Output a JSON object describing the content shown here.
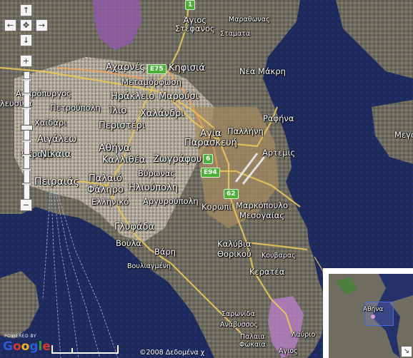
{
  "map": {
    "labels": {
      "agios_stefanos": "Άγιος\nΣτέφανος",
      "stamata": "Σταματα",
      "marathonas": "Μαραθωνας",
      "acharnes": "Αχαρνές",
      "kifisia": "Κηφισιά",
      "metamorfosi": "Μεταμόρφωση",
      "nea_makri": "Νέα Μάκρη",
      "aspropyrgos": "Ασπρόπυργος",
      "irakleio": "Ηράκλειο",
      "marousi": "Μαρούσι",
      "petroupoli": "Πετρούπολη",
      "ilio": "Ίλιο",
      "chalandri": "Χαλάνδρι",
      "elefsina": "λευσίνα",
      "chaidari": "Χαϊδάρι",
      "peristeri": "Περιστέρι",
      "rafina": "Ραφήνα",
      "agia_paraskevi": "Αγία\nΠαρασκευή",
      "pallini": "Παλλήνη",
      "aigaleo": "Αιγάλεω",
      "athina": "Αθήνα",
      "artemis": "Αρτεμις",
      "perama": "Πέραμα",
      "nikaia": "Νίκαια",
      "kallithea": "Καλλιθέα",
      "zografou": "Ζωγράφου",
      "megara": "Μεγα",
      "pireas": "Πειραιάς",
      "paleo_faliro": "Παλαιό\nΦάληρο",
      "vyronas": "Βύρωνας",
      "ilioupoli": "Ηλιούπολη",
      "korvpi": "Κορωπί",
      "markopoulo": "Μαρκόπουλο\nΜεσογαίας",
      "elliniko": "Ελληνικό",
      "argyroupoli": "Αργυρούπολη",
      "glyfada": "Γλυφάδα",
      "kalyvia": "Καλύβια\nΘορικού",
      "voula": "Βούλα",
      "vari": "Βάρη",
      "kouvaras": "Κουβαρας",
      "vouliagmeni": "Βουλιαγμένη",
      "keratea": "Κερατέα",
      "saronida": "Σαρωνίδα",
      "anavyssos": "Ανάβυσσος",
      "palaia_fokaia": "Παλαια\nΦώκαια",
      "lavrio": "Λαύριο",
      "agios": "Αγιος"
    },
    "shields": {
      "r1": "1",
      "e75": "E75",
      "r6": "6",
      "e94": "E94",
      "r62": "62"
    }
  },
  "controls": {
    "pan_up": "↑",
    "pan_left": "←",
    "pan_center": "✥",
    "pan_right": "→",
    "pan_down": "↓",
    "zoom_in": "+",
    "zoom_out": "−"
  },
  "overview": {
    "label": "Αθήνα",
    "toggle": "↘"
  },
  "footer": {
    "powered_by": "POWERED BY",
    "google": "Google",
    "copyright": "©2008 Δεδομένα χ"
  },
  "colors": {
    "sea": "#1e2a5c",
    "land": "#7a7668",
    "urban": "#b9b3a6",
    "road": "#e8c659",
    "shield": "#4caf3a"
  }
}
